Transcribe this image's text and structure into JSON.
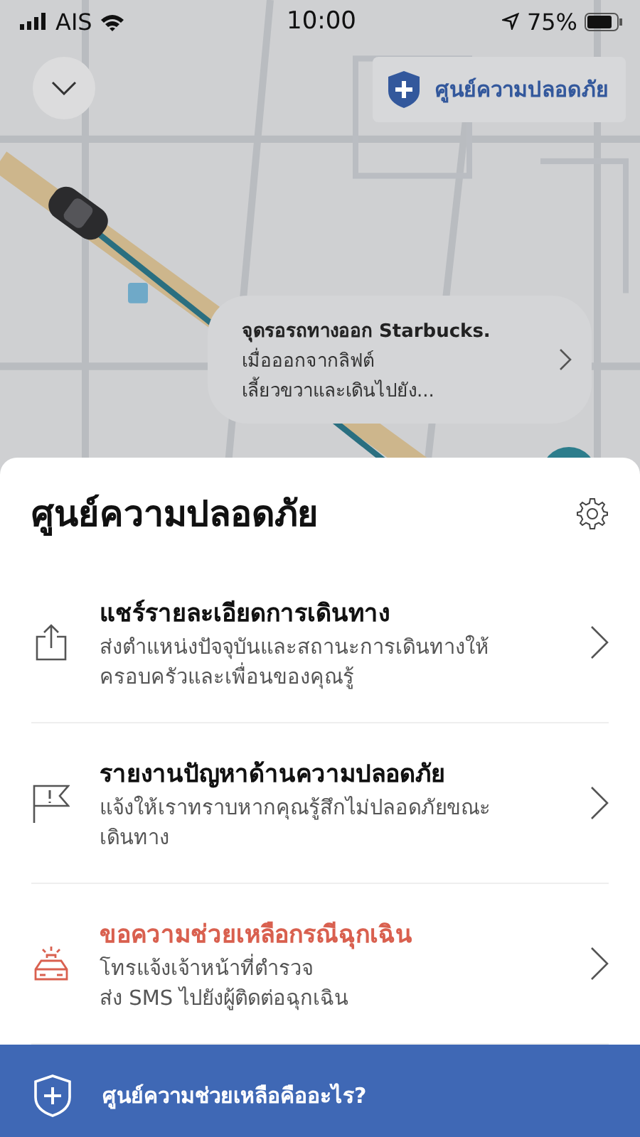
{
  "status_bar": {
    "carrier": "AIS",
    "time": "10:00",
    "battery": "75%"
  },
  "map": {
    "kind": "picture",
    "safety_button": {
      "label": "ศูนย์ความปลอดภัย"
    },
    "pickup_card": {
      "title": "จุดรอรถทางออก Starbucks.",
      "lines": [
        "เมื่อออกจากลิฟต์",
        "เลี้ยวขวาและเดินไปยัง..."
      ]
    }
  },
  "sheet": {
    "title": "ศูนย์ความปลอดภัย",
    "items": [
      {
        "kind": "share",
        "title": "แชร์รายละเอียดการเดินทาง",
        "lines": [
          "ส่งตำแหน่งปัจจุบันและสถานะการเดินทางให้",
          "ครอบครัวและเพื่อนของคุณรู้"
        ]
      },
      {
        "kind": "report",
        "title": "รายงานปัญหาด้านความปลอดภัย",
        "lines": [
          "แจ้งให้เราทราบหากคุณรู้สึกไม่ปลอดภัยขณะ",
          "เดินทาง"
        ]
      },
      {
        "kind": "emergency",
        "title": "ขอความช่วยเหลือกรณีฉุกเฉิน",
        "lines": [
          "โทรแจ้งเจ้าหน้าที่ตำรวจ",
          "ส่ง SMS ไปยังผู้ติดต่อฉุกเฉิน"
        ]
      }
    ]
  },
  "footer": {
    "label": "ศูนย์ความช่วยเหลือคืออะไร?"
  }
}
